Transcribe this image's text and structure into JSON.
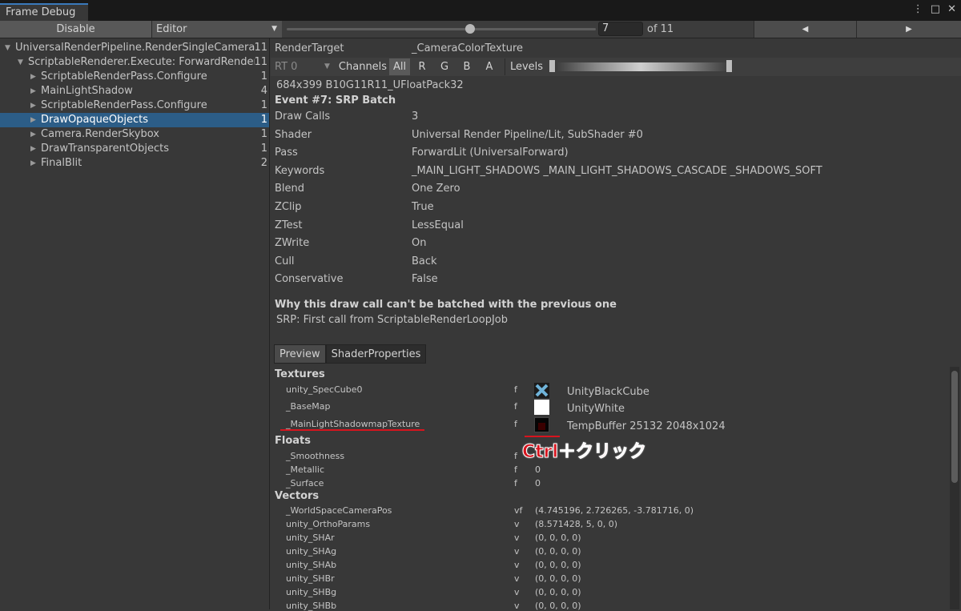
{
  "window": {
    "tab_title": "Frame Debug",
    "controls": [
      "⋮",
      "□",
      "✕"
    ]
  },
  "toolbar": {
    "disable_label": "Disable",
    "target_label": "Editor",
    "event_number": "7",
    "event_total_label": "of 11",
    "event_progress_fraction": 0.58,
    "prev_icon": "◀",
    "next_icon": "▶"
  },
  "tree": {
    "items": [
      {
        "label": "UniversalRenderPipeline.RenderSingleCamera",
        "count": "11",
        "expanded": true,
        "level": 0
      },
      {
        "label": "ScriptableRenderer.Execute: ForwardRenderer",
        "count": "11",
        "expanded": true,
        "level": 1
      },
      {
        "label": "ScriptableRenderPass.Configure",
        "count": "1",
        "expanded": false,
        "level": 2
      },
      {
        "label": "MainLightShadow",
        "count": "4",
        "expanded": false,
        "level": 2
      },
      {
        "label": "ScriptableRenderPass.Configure",
        "count": "1",
        "expanded": false,
        "level": 2
      },
      {
        "label": "DrawOpaqueObjects",
        "count": "1",
        "expanded": false,
        "level": 2,
        "selected": true
      },
      {
        "label": "Camera.RenderSkybox",
        "count": "1",
        "expanded": false,
        "level": 2
      },
      {
        "label": "DrawTransparentObjects",
        "count": "1",
        "expanded": false,
        "level": 2
      },
      {
        "label": "FinalBlit",
        "count": "2",
        "expanded": false,
        "level": 2
      }
    ]
  },
  "details": {
    "render_target_label": "RenderTarget",
    "render_target_value": "_CameraColorTexture",
    "rt_select": "RT 0",
    "channels_label": "Channels",
    "channels": [
      "All",
      "R",
      "G",
      "B",
      "A"
    ],
    "levels_label": "Levels",
    "format": "684x399 B10G11R11_UFloatPack32",
    "event_title": "Event #7: SRP Batch",
    "rows": [
      {
        "label": "Draw Calls",
        "value": "3"
      },
      {
        "label": "Shader",
        "value": "Universal Render Pipeline/Lit, SubShader #0"
      },
      {
        "label": "Pass",
        "value": "ForwardLit (UniversalForward)"
      },
      {
        "label": "Keywords",
        "value": "_MAIN_LIGHT_SHADOWS _MAIN_LIGHT_SHADOWS_CASCADE _SHADOWS_SOFT"
      },
      {
        "label": "Blend",
        "value": "One Zero"
      },
      {
        "label": "ZClip",
        "value": "True"
      },
      {
        "label": "ZTest",
        "value": "LessEqual"
      },
      {
        "label": "ZWrite",
        "value": "On"
      },
      {
        "label": "Cull",
        "value": "Back"
      },
      {
        "label": "Conservative",
        "value": "False"
      }
    ],
    "batch_heading": "Why this draw call can't be batched with the previous one",
    "batch_reason": "SRP: First call from ScriptableRenderLoopJob"
  },
  "props": {
    "tabs": [
      "Preview",
      "ShaderProperties"
    ],
    "textures_heading": "Textures",
    "textures": [
      {
        "name": "unity_SpecCube0",
        "type": "f",
        "value": "UnityBlackCube"
      },
      {
        "name": "_BaseMap",
        "type": "f",
        "value": "UnityWhite"
      },
      {
        "name": "_MainLightShadowmapTexture",
        "type": "f",
        "value": "TempBuffer 25132 2048x1024"
      }
    ],
    "floats_heading": "Floats",
    "floats": [
      {
        "name": "_Smoothness",
        "type": "f",
        "value": ""
      },
      {
        "name": "_Metallic",
        "type": "f",
        "value": "0"
      },
      {
        "name": "_Surface",
        "type": "f",
        "value": "0"
      }
    ],
    "vectors_heading": "Vectors",
    "vectors": [
      {
        "name": "_WorldSpaceCameraPos",
        "type": "vf",
        "value": "(4.745196, 2.726265, -3.781716, 0)"
      },
      {
        "name": "unity_OrthoParams",
        "type": "v",
        "value": "(8.571428, 5, 0, 0)"
      },
      {
        "name": "unity_SHAr",
        "type": "v",
        "value": "(0, 0, 0, 0)"
      },
      {
        "name": "unity_SHAg",
        "type": "v",
        "value": "(0, 0, 0, 0)"
      },
      {
        "name": "unity_SHAb",
        "type": "v",
        "value": "(0, 0, 0, 0)"
      },
      {
        "name": "unity_SHBr",
        "type": "v",
        "value": "(0, 0, 0, 0)"
      },
      {
        "name": "unity_SHBg",
        "type": "v",
        "value": "(0, 0, 0, 0)"
      },
      {
        "name": "unity_SHBb",
        "type": "v",
        "value": "(0, 0, 0, 0)"
      }
    ]
  },
  "annotation": {
    "text": "Ctrl＋クリック",
    "color": "#d7141e"
  }
}
